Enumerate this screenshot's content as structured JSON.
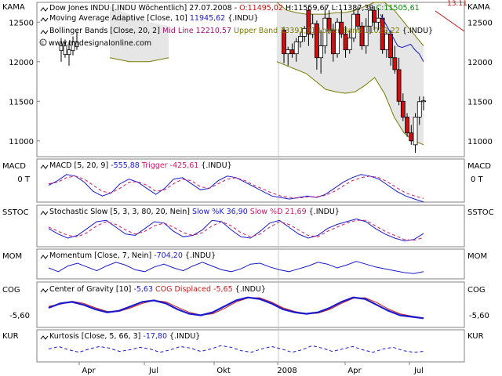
{
  "chart_data": [
    {
      "type": "candlestick",
      "panel": "price",
      "side_label": "KAMA",
      "legend": [
        {
          "prefix": "",
          "text": "Dow Jones INDU [.INDU  Wöchentlich] 27.07.2008 - ",
          "o_label": "O:11495,02",
          "h_label": "H:11559,67",
          "l_label": "L:11387,39",
          "c_label": "C:11505,61"
        },
        {
          "text": "Moving Average Adaptive [Close, 10]",
          "value": "11945,62",
          "suffix": "{.INDU}"
        },
        {
          "text": "Bollinger Bands [Close, 20, 2]",
          "mid": "Mid Line 12210,57",
          "upper": "Upper Band 13391,91",
          "lower": "Lower Band 11029,22",
          "suffix": "{.INDU}"
        }
      ],
      "watermark": "www.tradesignalonline.com",
      "corner_value": "13.11",
      "y_ticks": [
        12500,
        12000,
        11500,
        11000
      ],
      "ylim": [
        10800,
        12750
      ],
      "candles": [
        {
          "o": 12400,
          "h": 12440,
          "l": 11980,
          "c": 12100
        },
        {
          "o": 12100,
          "h": 12190,
          "l": 11950,
          "c": 12150
        },
        {
          "o": 12150,
          "h": 12230,
          "l": 12050,
          "c": 12100
        },
        {
          "o": 12100,
          "h": 12300,
          "l": 12000,
          "c": 12250
        },
        {
          "o": 12250,
          "h": 12380,
          "l": 12180,
          "c": 12320
        },
        {
          "o": 12320,
          "h": 12450,
          "l": 12250,
          "c": 12420
        },
        {
          "o": 12650,
          "h": 12700,
          "l": 12200,
          "c": 12350
        },
        {
          "o": 12350,
          "h": 12600,
          "l": 12300,
          "c": 12480
        },
        {
          "o": 12480,
          "h": 12520,
          "l": 11900,
          "c": 12050
        },
        {
          "o": 12050,
          "h": 12400,
          "l": 11850,
          "c": 12200
        },
        {
          "o": 12200,
          "h": 12700,
          "l": 12100,
          "c": 12550
        },
        {
          "o": 12550,
          "h": 12650,
          "l": 12350,
          "c": 12400
        },
        {
          "o": 12400,
          "h": 12480,
          "l": 12000,
          "c": 12100
        },
        {
          "o": 12100,
          "h": 12550,
          "l": 12050,
          "c": 12500
        },
        {
          "o": 12500,
          "h": 12650,
          "l": 12300,
          "c": 12350
        },
        {
          "o": 12350,
          "h": 12450,
          "l": 12050,
          "c": 12150
        },
        {
          "o": 12150,
          "h": 12400,
          "l": 12100,
          "c": 12300
        },
        {
          "o": 12300,
          "h": 12650,
          "l": 12250,
          "c": 12600
        },
        {
          "o": 12600,
          "h": 12700,
          "l": 12400,
          "c": 12450
        },
        {
          "o": 12450,
          "h": 12500,
          "l": 12150,
          "c": 12200
        },
        {
          "o": 12200,
          "h": 12550,
          "l": 12100,
          "c": 12450
        },
        {
          "o": 12450,
          "h": 12700,
          "l": 12350,
          "c": 12650
        },
        {
          "o": 12650,
          "h": 12700,
          "l": 12400,
          "c": 12500
        },
        {
          "o": 12500,
          "h": 12680,
          "l": 12400,
          "c": 12550
        },
        {
          "o": 12550,
          "h": 12600,
          "l": 12100,
          "c": 12150
        },
        {
          "o": 12150,
          "h": 12400,
          "l": 12050,
          "c": 12350
        },
        {
          "o": 12350,
          "h": 12400,
          "l": 11950,
          "c": 12050
        },
        {
          "o": 12050,
          "h": 12200,
          "l": 11850,
          "c": 11900
        },
        {
          "o": 11900,
          "h": 12050,
          "l": 11450,
          "c": 11500
        },
        {
          "o": 11500,
          "h": 11600,
          "l": 11250,
          "c": 11300
        },
        {
          "o": 11300,
          "h": 11350,
          "l": 11050,
          "c": 11100
        },
        {
          "o": 11100,
          "h": 11200,
          "l": 10950,
          "c": 11000
        },
        {
          "o": 10950,
          "h": 11350,
          "l": 10850,
          "c": 11300
        },
        {
          "o": 11300,
          "h": 11560,
          "l": 11200,
          "c": 11495
        },
        {
          "o": 11495,
          "h": 11560,
          "l": 11387,
          "c": 11506
        }
      ],
      "kama": [
        12600,
        12500,
        12400,
        12300,
        12200,
        12180,
        12200,
        12220,
        12150,
        12100,
        12000
      ],
      "bb_upper": [
        12750,
        12650,
        12620,
        12600,
        12600,
        12600,
        12620,
        12620,
        12650,
        12700,
        12750,
        12750,
        12650,
        12500,
        12350,
        12200
      ],
      "bb_lower": [
        12000,
        11950,
        11900,
        11850,
        11750,
        11650,
        11620,
        11600,
        11620,
        11700,
        11800,
        11600,
        11300,
        11100,
        11000,
        10950
      ],
      "left_bb_upper": [
        12700,
        12600,
        12500,
        12450
      ],
      "left_bb_lower": [
        12050,
        12000,
        12000,
        12050
      ]
    },
    {
      "type": "line",
      "panel": "macd",
      "side_label": "MACD",
      "legend": {
        "text": "MACD [5, 20, 9]",
        "value": "-555,88",
        "trigger": "Trigger -425,61",
        "suffix": "{.INDU}"
      },
      "y_ticks": [
        "0 T"
      ],
      "series": [
        {
          "name": "MACD",
          "values": [
            0.0,
            0.15,
            0.35,
            0.3,
            0.1,
            -0.2,
            -0.35,
            -0.25,
            0.05,
            0.2,
            0.1,
            -0.1,
            -0.3,
            -0.1,
            0.2,
            0.25,
            0.05,
            -0.15,
            -0.1,
            0.15,
            0.3,
            0.25,
            0.1,
            -0.05,
            -0.2,
            -0.35,
            -0.4,
            -0.45,
            -0.4,
            -0.35,
            -0.4,
            -0.3,
            -0.1,
            0.1,
            0.25,
            0.35,
            0.3,
            0.2,
            0.0,
            -0.2,
            -0.35,
            -0.45,
            -0.55
          ]
        },
        {
          "name": "Trigger",
          "values": [
            0.05,
            0.1,
            0.25,
            0.3,
            0.2,
            0.0,
            -0.2,
            -0.25,
            -0.1,
            0.1,
            0.12,
            0.0,
            -0.2,
            -0.15,
            0.05,
            0.2,
            0.15,
            -0.05,
            -0.1,
            0.05,
            0.2,
            0.25,
            0.15,
            0.0,
            -0.12,
            -0.25,
            -0.35,
            -0.4,
            -0.42,
            -0.38,
            -0.38,
            -0.33,
            -0.2,
            -0.02,
            0.15,
            0.25,
            0.3,
            0.25,
            0.1,
            -0.08,
            -0.25,
            -0.35,
            -0.43
          ]
        }
      ]
    },
    {
      "type": "line",
      "panel": "stochastic",
      "side_label": "SSTOC",
      "legend": {
        "text": "Stochastic Slow [5, 3, 3, 80, 20, Nein]",
        "k": "Slow %K 36,90",
        "d": "Slow %D 21,69",
        "suffix": "{.INDU}"
      },
      "series": [
        {
          "name": "Slow %K",
          "values": [
            0.55,
            0.35,
            0.2,
            0.3,
            0.55,
            0.8,
            0.85,
            0.6,
            0.35,
            0.3,
            0.55,
            0.8,
            0.75,
            0.45,
            0.25,
            0.3,
            0.5,
            0.85,
            0.8,
            0.5,
            0.25,
            0.2,
            0.45,
            0.75,
            0.85,
            0.6,
            0.35,
            0.2,
            0.3,
            0.55,
            0.7,
            0.8,
            0.9,
            0.8,
            0.55,
            0.35,
            0.2,
            0.1,
            0.15,
            0.37
          ]
        },
        {
          "name": "Slow %D",
          "values": [
            0.6,
            0.45,
            0.3,
            0.25,
            0.4,
            0.65,
            0.8,
            0.7,
            0.5,
            0.35,
            0.45,
            0.65,
            0.75,
            0.6,
            0.4,
            0.3,
            0.4,
            0.65,
            0.8,
            0.65,
            0.4,
            0.25,
            0.35,
            0.6,
            0.8,
            0.7,
            0.5,
            0.3,
            0.25,
            0.45,
            0.6,
            0.75,
            0.85,
            0.85,
            0.65,
            0.45,
            0.3,
            0.15,
            0.12,
            0.22
          ]
        }
      ]
    },
    {
      "type": "line",
      "panel": "momentum",
      "side_label": "MOM",
      "legend": {
        "text": "Momentum [Close, 7, Nein]",
        "value": "-704,20",
        "suffix": "{.INDU}"
      },
      "series": [
        {
          "name": "Momentum",
          "values": [
            0.5,
            0.3,
            0.6,
            0.75,
            0.55,
            0.35,
            0.6,
            0.8,
            0.65,
            0.4,
            0.3,
            0.55,
            0.7,
            0.5,
            0.35,
            0.6,
            0.8,
            0.6,
            0.4,
            0.3,
            0.45,
            0.7,
            0.75,
            0.55,
            0.4,
            0.3,
            0.45,
            0.6,
            0.8,
            0.7,
            0.5,
            0.65,
            0.85,
            0.7,
            0.55,
            0.45,
            0.35,
            0.25,
            0.2,
            0.3
          ]
        }
      ]
    },
    {
      "type": "line",
      "panel": "cog",
      "side_label": "COG",
      "legend": {
        "text": "Center of Gravity [10]",
        "value": "-5,63",
        "displaced": "COG Displaced -5,65",
        "suffix": "{.INDU}"
      },
      "y_ticks": [
        "-5,60"
      ],
      "series": [
        {
          "name": "Center of Gravity",
          "values": [
            0.5,
            0.65,
            0.7,
            0.6,
            0.45,
            0.35,
            0.4,
            0.55,
            0.7,
            0.75,
            0.65,
            0.45,
            0.3,
            0.25,
            0.35,
            0.55,
            0.75,
            0.85,
            0.8,
            0.65,
            0.45,
            0.35,
            0.3,
            0.35,
            0.5,
            0.7,
            0.85,
            0.8,
            0.6,
            0.4,
            0.25,
            0.2,
            0.15
          ]
        },
        {
          "name": "COG Displaced",
          "values": [
            0.55,
            0.62,
            0.72,
            0.65,
            0.5,
            0.38,
            0.38,
            0.5,
            0.65,
            0.75,
            0.7,
            0.52,
            0.35,
            0.26,
            0.3,
            0.48,
            0.7,
            0.83,
            0.84,
            0.7,
            0.5,
            0.38,
            0.3,
            0.32,
            0.45,
            0.65,
            0.82,
            0.84,
            0.68,
            0.46,
            0.3,
            0.22,
            0.16
          ]
        }
      ]
    },
    {
      "type": "line",
      "panel": "kurtosis",
      "side_label": "KUR",
      "legend": {
        "text": "Kurtosis [Close, 5, 66, 3]",
        "value": "-17,80",
        "suffix": "{.INDU}"
      },
      "series": [
        {
          "name": "Kurtosis",
          "values": [
            0.5,
            0.65,
            0.45,
            0.3,
            0.5,
            0.65,
            0.55,
            0.35,
            0.45,
            0.6,
            0.5,
            0.3,
            0.45,
            0.65,
            0.55,
            0.35,
            0.5,
            0.7,
            0.6,
            0.4,
            0.3,
            0.5,
            0.65,
            0.5,
            0.3,
            0.45,
            0.7,
            0.55,
            0.35,
            0.5,
            0.65,
            0.45,
            0.3,
            0.5,
            0.6,
            0.4,
            0.3,
            0.35
          ]
        }
      ]
    }
  ],
  "x_axis": {
    "tick_labels": [
      "Apr",
      "Jul",
      "Okt",
      "2008",
      "Apr",
      "Jul"
    ]
  },
  "colors": {
    "candle_up": "#ffffff",
    "candle_down": "#d01010",
    "kama": "#1a1acc",
    "bollinger": "#7a7a00",
    "bollinger_fill": "#e6e6e6",
    "macd": "#1a1acc",
    "trigger": "#cc1a6a",
    "momentum": "#1a1acc",
    "kurtosis": "#1a1acc",
    "cog": "#1a1acc",
    "cog_displaced": "#cc1a1a"
  }
}
